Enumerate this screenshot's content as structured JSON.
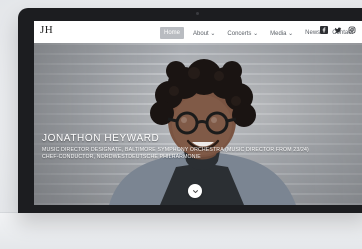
{
  "site": {
    "logo": "JH",
    "nav": {
      "items": [
        {
          "label": "Home",
          "active": true
        },
        {
          "label": "About",
          "dropdown": true
        },
        {
          "label": "Concerts",
          "dropdown": true
        },
        {
          "label": "Media",
          "dropdown": true
        },
        {
          "label": "News",
          "dropdown": false
        },
        {
          "label": "Contact",
          "dropdown": false
        }
      ],
      "dropdown_caret": "⌄",
      "social_icons": [
        "facebook-icon",
        "twitter-icon",
        "instagram-icon"
      ]
    },
    "hero": {
      "name": "JONATHON HEYWARD",
      "line1": "MUSIC DIRECTOR DESIGNATE, BALTIMORE SYMPHONY ORCHESTRA (MUSIC DIRECTOR FROM 23/24)",
      "line2": "CHEF-CONDUCTOR, NORDWESTDEUTSCHE PHILHARMONIE"
    }
  },
  "colors": {
    "nav_active_bg": "#b9bcc1",
    "nav_text": "#5a5f66",
    "hero_text": "#ffffff",
    "bezel": "#1c1d20"
  }
}
